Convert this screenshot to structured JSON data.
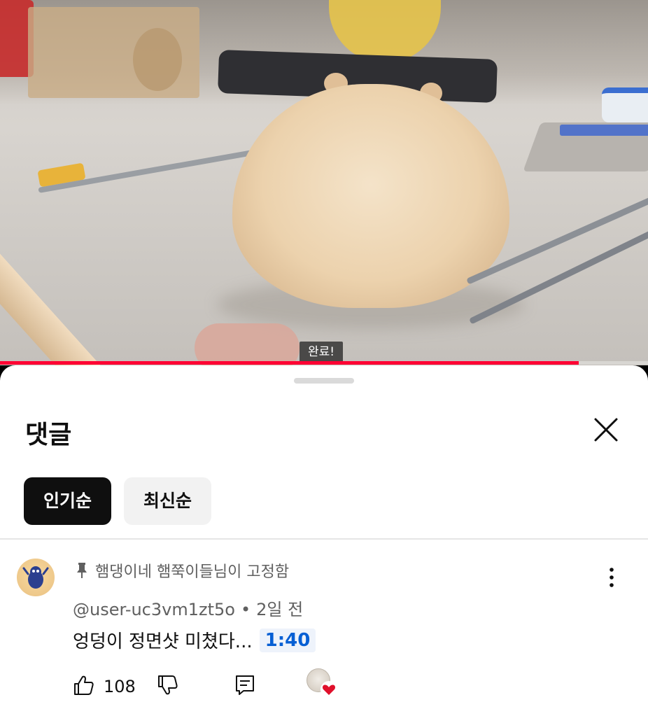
{
  "video": {
    "caption": "완료!",
    "progress": 0.893,
    "progress_color": "#ff0033"
  },
  "comments": {
    "title": "댓글",
    "close_icon": "close-icon",
    "sort": {
      "popular": "인기순",
      "newest": "최신순",
      "selected": "인기순"
    },
    "pinned_comment": {
      "pinned_label": "햄댕이네 햄쭉이들님이 고정함",
      "author": "@user-uc3vm1zt5o",
      "separator": "•",
      "time": "2일 전",
      "text": "엉덩이 정면샷 미쳤다...",
      "timestamp_link": "1:40",
      "likes": "108"
    }
  },
  "colors": {
    "link": "#065fd4",
    "active_chip": "#0f0f0f",
    "heart": "#e0102b"
  }
}
